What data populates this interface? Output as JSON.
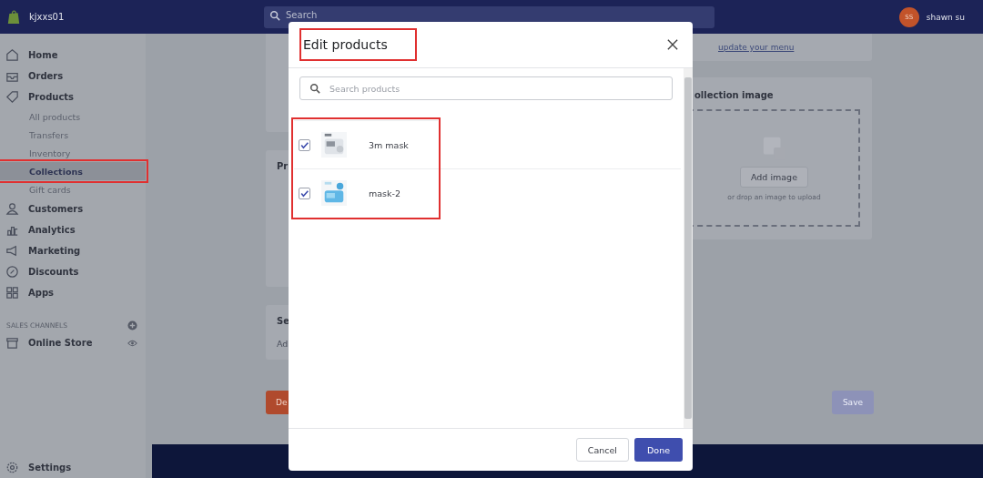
{
  "top_bar": {
    "store_name": "kjxxs01",
    "search_placeholder": "Search",
    "user": {
      "initials": "SS",
      "name": "shawn su"
    }
  },
  "sidebar": {
    "items": [
      {
        "label": "Home",
        "selected": false,
        "highlighted": false
      },
      {
        "label": "Orders",
        "selected": false,
        "highlighted": false
      },
      {
        "label": "Products",
        "selected": false,
        "highlighted": false,
        "children": [
          {
            "label": "All products",
            "selected": false,
            "highlighted": false
          },
          {
            "label": "Transfers",
            "selected": false,
            "highlighted": false
          },
          {
            "label": "Inventory",
            "selected": false,
            "highlighted": false
          },
          {
            "label": "Collections",
            "selected": true,
            "highlighted": true
          },
          {
            "label": "Gift cards",
            "selected": false,
            "highlighted": false
          }
        ]
      },
      {
        "label": "Customers",
        "selected": false,
        "highlighted": false
      },
      {
        "label": "Analytics",
        "selected": false,
        "highlighted": false
      },
      {
        "label": "Marketing",
        "selected": false,
        "highlighted": false
      },
      {
        "label": "Discounts",
        "selected": false,
        "highlighted": false
      },
      {
        "label": "Apps",
        "selected": false,
        "highlighted": false
      }
    ],
    "sales_channels": {
      "heading": "SALES CHANNELS",
      "items": [
        {
          "label": "Online Store"
        }
      ]
    },
    "settings": "Settings"
  },
  "page": {
    "menu_link": "update your menu",
    "products_card_title": "Pr",
    "seo_card_title": "Se",
    "seo_card_text": "Ad",
    "collection_image": {
      "title": "ollection image",
      "button": "Add image",
      "hint": "or drop an image to upload"
    },
    "delete_button": "De",
    "save_button": "Save"
  },
  "modal": {
    "title": "Edit products",
    "title_highlighted": true,
    "search_placeholder": "Search products",
    "list_highlighted": true,
    "products": [
      {
        "name": "3m mask",
        "checked": true,
        "kind": "picture"
      },
      {
        "name": "mask-2",
        "checked": true,
        "kind": "picture"
      }
    ],
    "buttons": [
      {
        "label": "Cancel",
        "kind": "secondary"
      },
      {
        "label": "Done",
        "kind": "primary"
      }
    ]
  }
}
